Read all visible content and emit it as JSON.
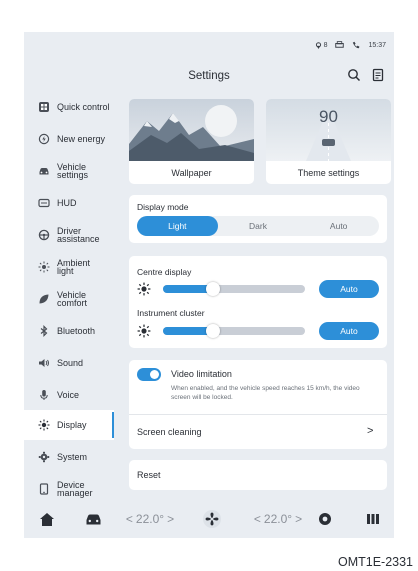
{
  "status_bar": {
    "signal": "8",
    "time": "15:37"
  },
  "header": {
    "title": "Settings"
  },
  "sidebar": {
    "items": [
      {
        "label": "Quick control",
        "icon": "quick-control-icon"
      },
      {
        "label": "New energy",
        "icon": "new-energy-icon"
      },
      {
        "label": "Vehicle settings",
        "icon": "car-icon"
      },
      {
        "label": "HUD",
        "icon": "hud-icon"
      },
      {
        "label": "Driver assistance",
        "icon": "steering-wheel-icon"
      },
      {
        "label": "Ambient light",
        "icon": "ambient-light-icon"
      },
      {
        "label": "Vehicle comfort",
        "icon": "leaf-icon"
      },
      {
        "label": "Bluetooth",
        "icon": "bluetooth-icon"
      },
      {
        "label": "Sound",
        "icon": "speaker-icon"
      },
      {
        "label": "Voice",
        "icon": "microphone-icon"
      },
      {
        "label": "Display",
        "icon": "sun-icon",
        "active": true
      },
      {
        "label": "System",
        "icon": "gear-icon"
      },
      {
        "label": "Device manager",
        "icon": "tablet-icon"
      }
    ]
  },
  "cards": {
    "wallpaper_label": "Wallpaper",
    "theme_label": "Theme settings",
    "theme_number": "90"
  },
  "display_mode": {
    "label": "Display mode",
    "options": [
      "Light",
      "Dark",
      "Auto"
    ],
    "selected": "Light"
  },
  "centre_display": {
    "label": "Centre display",
    "level": 0.35,
    "auto_label": "Auto"
  },
  "instrument_cluster": {
    "label": "Instrument cluster",
    "level": 0.35,
    "auto_label": "Auto"
  },
  "video_limitation": {
    "label": "Video limitation",
    "enabled": true,
    "description": "When enabled, and the vehicle speed reaches 15 km/h, the video screen will be locked."
  },
  "screen_cleaning": {
    "label": "Screen cleaning",
    "chevron": ">"
  },
  "reset": {
    "label": "Reset"
  },
  "dock": {
    "left_temp": "22.0°",
    "right_temp": "22.0°",
    "left_arrow": "<",
    "right_arrow": ">"
  },
  "caption": "OMT1E-2331",
  "colors": {
    "accent": "#2d8fd8",
    "background": "#e9edf2"
  }
}
